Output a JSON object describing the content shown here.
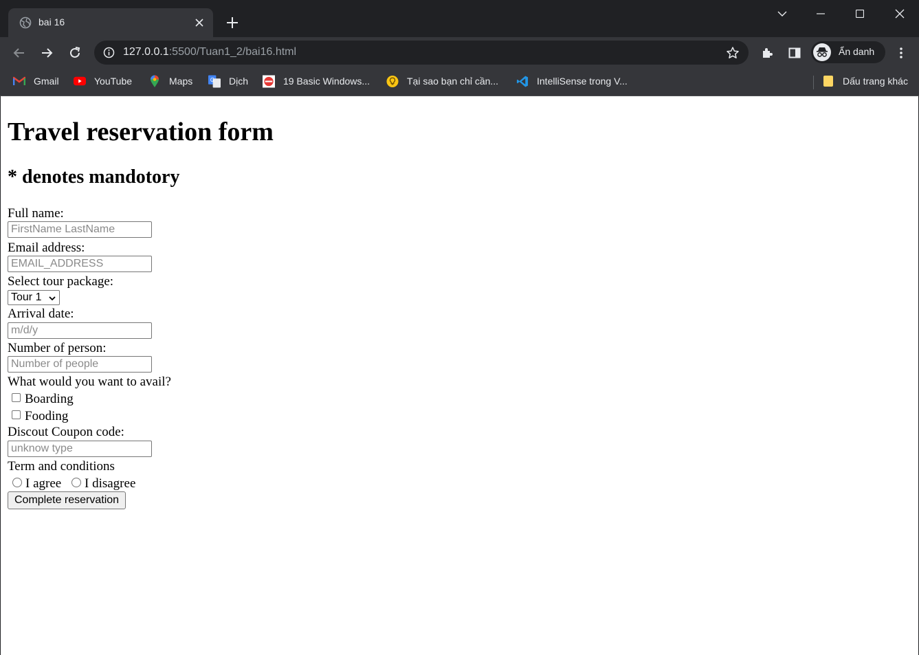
{
  "browser": {
    "tab": {
      "title": "bai 16"
    },
    "url": {
      "host": "127.0.0.1",
      "rest": ":5500/Tuan1_2/bai16.html"
    },
    "profile_label": "Ẩn danh",
    "bookmarks": [
      {
        "label": "Gmail",
        "icon": "gmail-icon"
      },
      {
        "label": "YouTube",
        "icon": "youtube-icon"
      },
      {
        "label": "Maps",
        "icon": "maps-icon"
      },
      {
        "label": "Dịch",
        "icon": "translate-icon"
      },
      {
        "label": "19 Basic Windows...",
        "icon": "site-icon"
      },
      {
        "label": "Tại sao bạn chỉ cần...",
        "icon": "bulb-icon"
      },
      {
        "label": "IntelliSense trong V...",
        "icon": "vscode-icon"
      }
    ],
    "other_bookmarks": "Dấu trang khác"
  },
  "page": {
    "title": "Travel reservation form",
    "subtitle": "* denotes mandotory",
    "fields": {
      "full_name": {
        "label": "Full name:",
        "placeholder": "FirstName LastName"
      },
      "email": {
        "label": "Email address:",
        "placeholder": "EMAIL_ADDRESS"
      },
      "tour": {
        "label": "Select tour package:",
        "value": "Tour 1"
      },
      "arrival": {
        "label": "Arrival date:",
        "placeholder": "m/d/y"
      },
      "persons": {
        "label": "Number of person:",
        "placeholder": "Number of people"
      },
      "avail": {
        "label": "What would you want to avail?",
        "options": [
          "Boarding",
          "Fooding"
        ]
      },
      "coupon": {
        "label": "Discout Coupon code:",
        "placeholder": "unknow type"
      },
      "terms": {
        "label": "Term and conditions",
        "options": [
          "I agree",
          "I disagree"
        ]
      }
    },
    "submit_label": "Complete reservation"
  }
}
